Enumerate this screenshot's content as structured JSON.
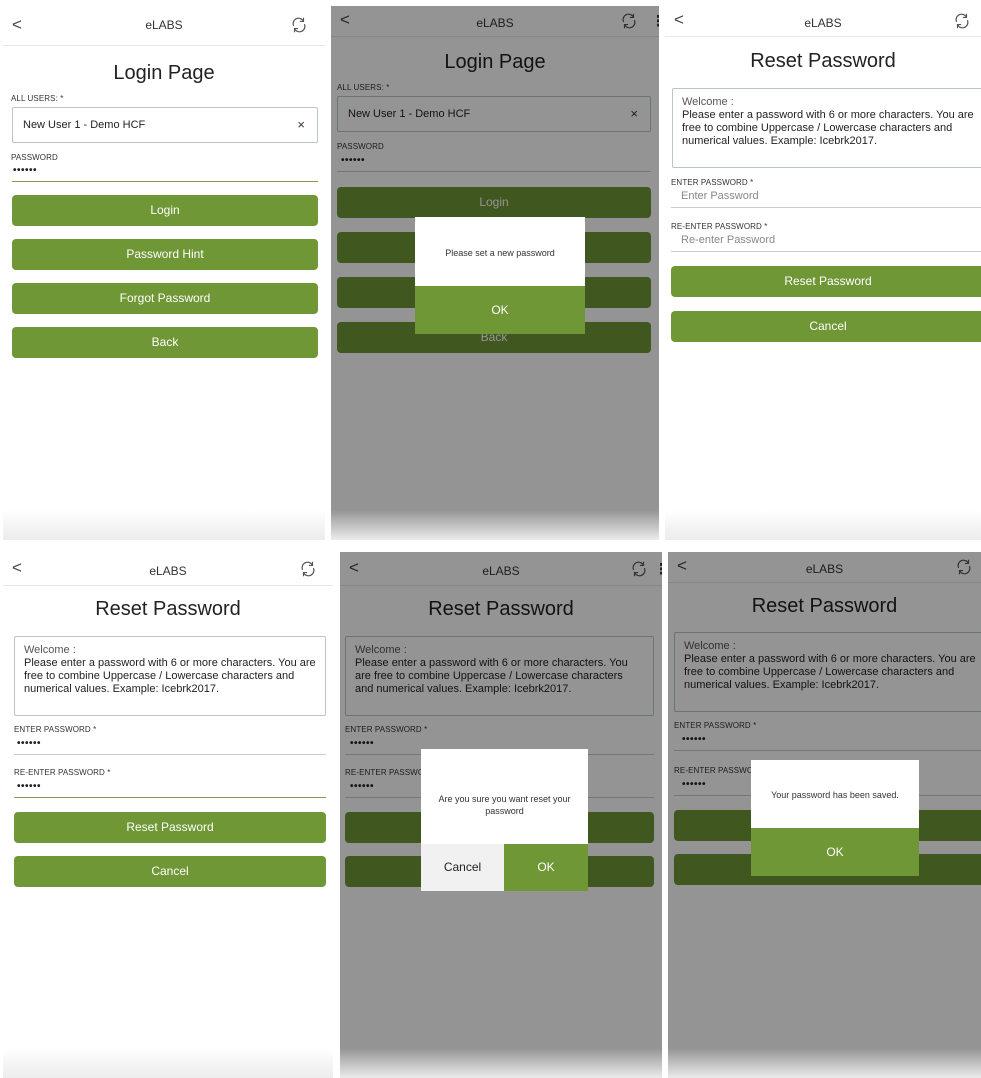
{
  "app": {
    "title": "eLABS",
    "back_glyph": "<",
    "kebab_glyph": "⋮",
    "icons": {
      "back": "chevron-left-icon",
      "sync": "sync-icon",
      "menu": "kebab-menu-icon"
    },
    "colors": {
      "accent": "#6f9736",
      "overlay": "rgba(0,0,0,0.42)"
    }
  },
  "login": {
    "page_title": "Login Page",
    "users_label": "ALL USERS: *",
    "selected_user": "New User 1 - Demo HCF",
    "clear_glyph": "×",
    "password_label": "PASSWORD",
    "password_value": "••••••",
    "login_button": "Login",
    "hint_button": "Password Hint",
    "forgot_button": "Forgot Password",
    "back_button": "Back"
  },
  "dialog_new_password": {
    "message": "Please set a new password",
    "ok": "OK"
  },
  "reset": {
    "page_title": "Reset Password",
    "welcome_title": "Welcome :",
    "welcome_body": "Please enter a password with 6 or more characters. You are free to combine Uppercase / Lowercase characters and numerical values. Example: Icebrk2017.",
    "enter_label": "ENTER PASSWORD *",
    "enter_placeholder": "Enter Password",
    "reenter_label": "RE-ENTER PASSWORD *",
    "reenter_placeholder": "Re-enter Password",
    "enter_label_truncated": "RE-ENTER PASSWO",
    "password_value": "••••••",
    "reset_button": "Reset Password",
    "cancel_button": "Cancel"
  },
  "dialog_confirm": {
    "message": "Are you sure you want reset your password",
    "cancel": "Cancel",
    "ok": "OK"
  },
  "dialog_saved": {
    "message": "Your password has been saved.",
    "ok": "OK"
  }
}
